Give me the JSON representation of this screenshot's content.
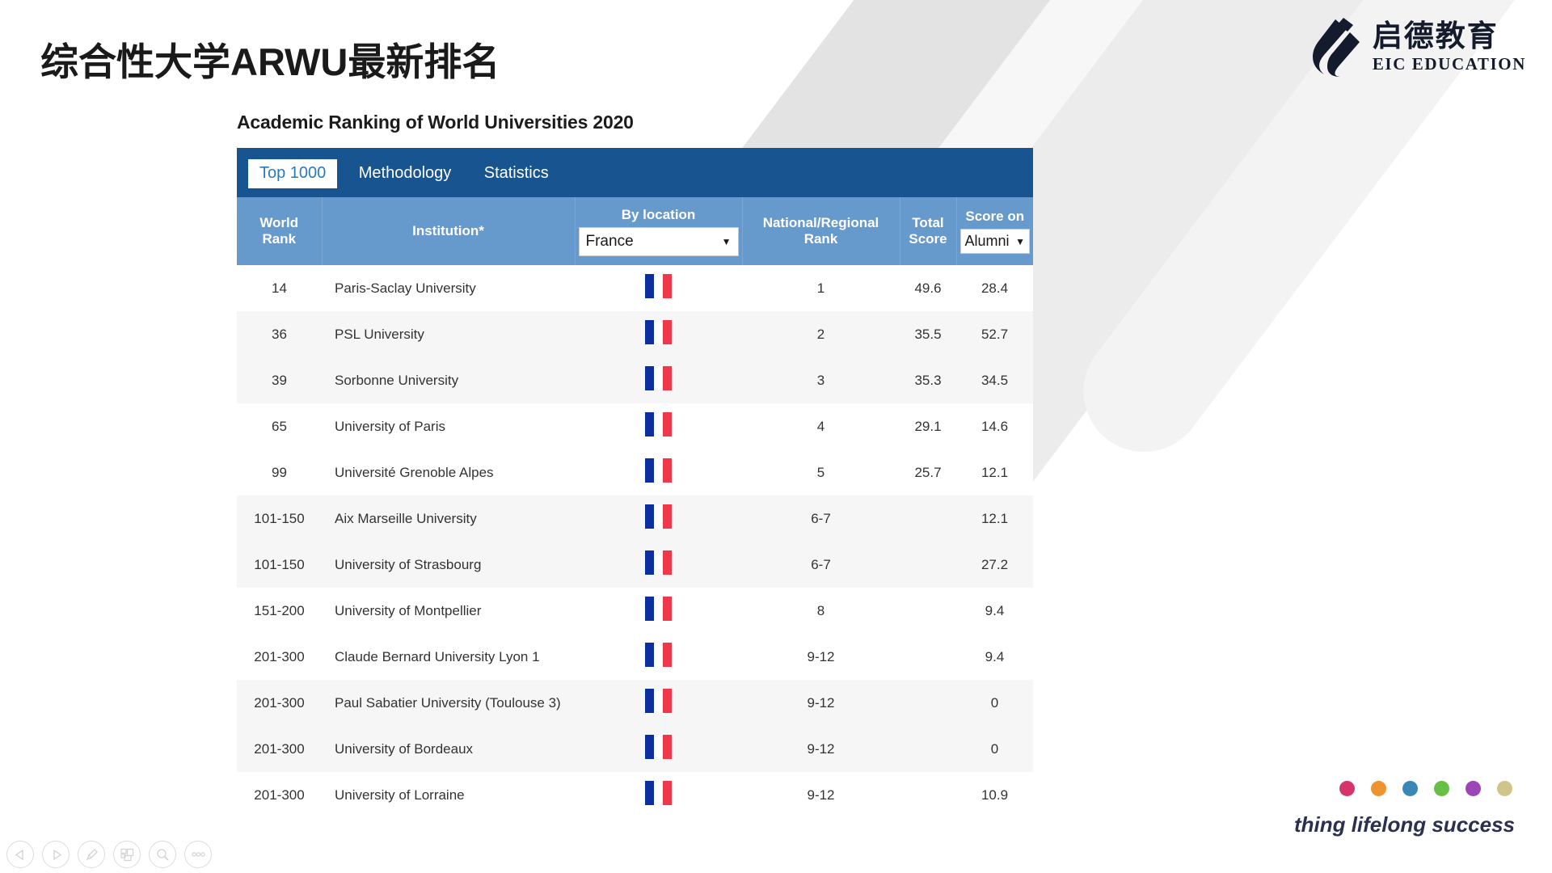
{
  "slide": {
    "title": "综合性大学ARWU最新排名"
  },
  "logo": {
    "cn": "启德教育",
    "en": "EIC EDUCATION",
    "mark_icon": "eic-swoosh-icon"
  },
  "arwu": {
    "heading": "Academic Ranking of World Universities 2020",
    "tabs": [
      {
        "label": "Top 1000",
        "active": true
      },
      {
        "label": "Methodology",
        "active": false
      },
      {
        "label": "Statistics",
        "active": false
      }
    ],
    "columns": {
      "world_rank": "World\nRank",
      "world_rank_line1": "World",
      "world_rank_line2": "Rank",
      "institution": "Institution*",
      "by_location": "By location",
      "location_value": "France",
      "national_rank_line1": "National/Regional",
      "national_rank_line2": "Rank",
      "total_score_line1": "Total",
      "total_score_line2": "Score",
      "score_on": "Score on",
      "score_on_value": "Alumni",
      "caret_glyph": "▼"
    },
    "flag_icon": "france-flag-icon",
    "rows": [
      {
        "world_rank": "14",
        "institution": "Paris-Saclay University",
        "national_rank": "1",
        "total_score": "49.6",
        "score_on": "28.4"
      },
      {
        "world_rank": "36",
        "institution": "PSL University",
        "national_rank": "2",
        "total_score": "35.5",
        "score_on": "52.7"
      },
      {
        "world_rank": "39",
        "institution": "Sorbonne University",
        "national_rank": "3",
        "total_score": "35.3",
        "score_on": "34.5"
      },
      {
        "world_rank": "65",
        "institution": "University of Paris",
        "national_rank": "4",
        "total_score": "29.1",
        "score_on": "14.6"
      },
      {
        "world_rank": "99",
        "institution": "Université Grenoble Alpes",
        "national_rank": "5",
        "total_score": "25.7",
        "score_on": "12.1"
      },
      {
        "world_rank": "101-150",
        "institution": "Aix Marseille University",
        "national_rank": "6-7",
        "total_score": "",
        "score_on": "12.1"
      },
      {
        "world_rank": "101-150",
        "institution": "University of Strasbourg",
        "national_rank": "6-7",
        "total_score": "",
        "score_on": "27.2"
      },
      {
        "world_rank": "151-200",
        "institution": "University of Montpellier",
        "national_rank": "8",
        "total_score": "",
        "score_on": "9.4"
      },
      {
        "world_rank": "201-300",
        "institution": "Claude Bernard University Lyon 1",
        "national_rank": "9-12",
        "total_score": "",
        "score_on": "9.4"
      },
      {
        "world_rank": "201-300",
        "institution": "Paul Sabatier University (Toulouse 3)",
        "national_rank": "9-12",
        "total_score": "",
        "score_on": "0"
      },
      {
        "world_rank": "201-300",
        "institution": "University of Bordeaux",
        "national_rank": "9-12",
        "total_score": "",
        "score_on": "0"
      },
      {
        "world_rank": "201-300",
        "institution": "University of Lorraine",
        "national_rank": "9-12",
        "total_score": "",
        "score_on": "10.9"
      }
    ]
  },
  "brand": {
    "tagline": "thing lifelong success",
    "dot_colors": [
      "#d6356a",
      "#ef9331",
      "#3a87b5",
      "#67c044",
      "#9b45b8",
      "#cfc48a"
    ]
  },
  "toolbar": {
    "items": [
      {
        "icon": "previous-slide-icon"
      },
      {
        "icon": "next-slide-icon"
      },
      {
        "icon": "pen-icon"
      },
      {
        "icon": "slide-grid-icon"
      },
      {
        "icon": "magnifier-icon"
      },
      {
        "icon": "more-options-icon"
      }
    ]
  },
  "colors": {
    "tabbar_blue": "#18548f",
    "header_blue": "#6699cc",
    "tab_active_text": "#2a7ac0",
    "flag_blue": "#0b2f9e",
    "flag_red": "#f0384b"
  }
}
